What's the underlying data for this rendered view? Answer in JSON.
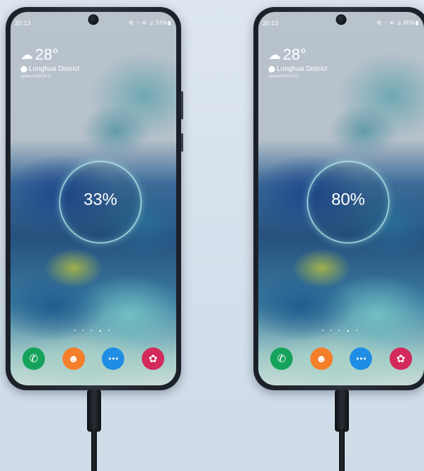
{
  "phones": [
    {
      "status_time": "20:13",
      "status_icons": "⚙ ◔ ≋ ⊿ 33%▮",
      "weather": {
        "temperature": "28°",
        "location": "Longhua District",
        "updated": "Updated 5/28 20:12"
      },
      "charge": "33%",
      "icons": [
        "phone-icon",
        "contacts-icon",
        "messages-icon",
        "gallery-icon"
      ]
    },
    {
      "status_time": "20:13",
      "status_icons": "⚙ ◔ ≋ ⊿ 80%▮",
      "weather": {
        "temperature": "28°",
        "location": "Longhua District",
        "updated": "Updated 5/28 20:12"
      },
      "charge": "80%",
      "icons": [
        "phone-icon",
        "contacts-icon",
        "messages-icon",
        "gallery-icon"
      ]
    }
  ],
  "colors": {
    "background": "#dde6f0",
    "phone_app": "#15a35b",
    "contacts_app": "#f47f2b",
    "messages_app": "#1f8de4",
    "gallery_app": "#d32a5b"
  }
}
